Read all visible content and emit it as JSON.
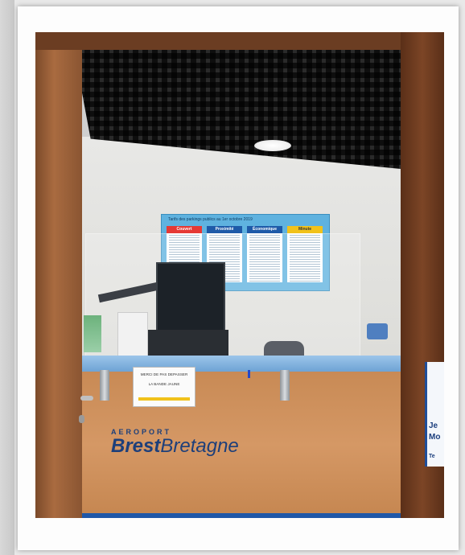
{
  "scene": {
    "counter_notice": {
      "line1": "MERCI DE PAS DEPASSER",
      "line2": "LA BANDE JAUNE"
    },
    "logo": {
      "small": "AEROPORT",
      "word1": "Brest",
      "word2": "Bretagne"
    },
    "price_board": {
      "title": "Tarifs des parkings publics au 1er octobre 2019",
      "columns": [
        "Couvert",
        "Proximité",
        "Économique",
        "Minute"
      ],
      "column_colors": [
        "#e53935",
        "#1e5aa8",
        "#1e5aa8",
        "#f1c21b"
      ]
    },
    "right_sign": {
      "fragments": [
        "Je",
        "Mo",
        "Te"
      ]
    }
  }
}
